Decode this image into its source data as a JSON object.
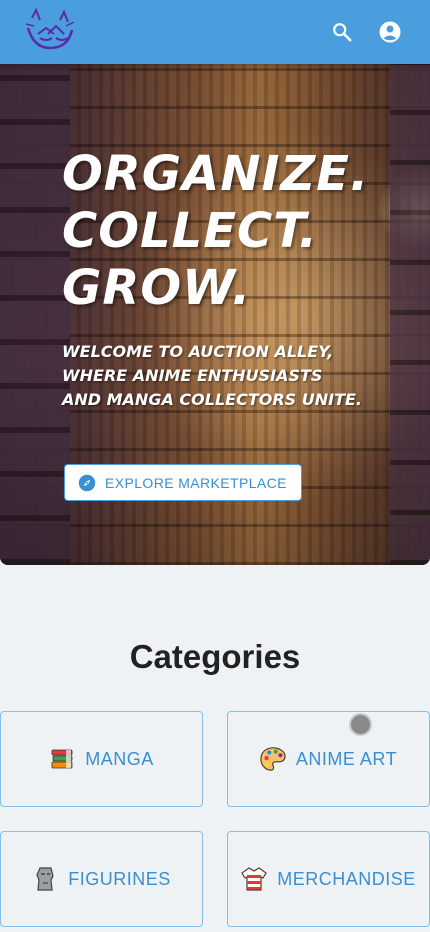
{
  "header": {
    "logo_text": "AA",
    "bar_color": "#4b9ede",
    "icons": [
      "search-icon",
      "account-circle-icon"
    ]
  },
  "hero": {
    "title_lines": [
      "ORGANIZE.",
      "COLLECT.",
      "GROW."
    ],
    "subtitle": "Welcome to Auction Alley, where anime enthusiasts and manga collectors unite.",
    "cta_label": "EXPLORE MARKETPLACE",
    "cta_icon": "compass-icon"
  },
  "categories": {
    "title": "Categories",
    "items": [
      {
        "label": "MANGA",
        "icon": "books-icon"
      },
      {
        "label": "ANIME ART",
        "icon": "palette-icon"
      },
      {
        "label": "FIGURINES",
        "icon": "moai-icon"
      },
      {
        "label": "MERCHANDISE",
        "icon": "shirt-icon"
      }
    ]
  },
  "colors": {
    "accent": "#4b9ede",
    "link_text": "#3a8fd0",
    "background": "#eff2f5"
  }
}
